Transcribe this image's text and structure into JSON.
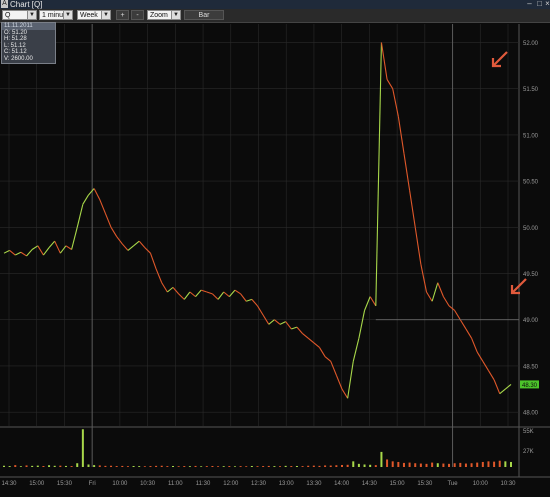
{
  "window": {
    "title": "Chart [Q]",
    "icon": "chart-app-icon"
  },
  "toolbar": {
    "symbol": "Q",
    "interval": "1 minute",
    "period": "Week",
    "plus_label": "+",
    "minus_label": "-",
    "zoom_label": "Zoom",
    "chart_type_label": "Bar"
  },
  "ohlc_box": {
    "header": "11.11.2011",
    "open": "O: 51.20",
    "high": "H: 51.28",
    "low": "L: 51.12",
    "close": "C: 51.12",
    "volume": "V: 2600.00"
  },
  "colors": {
    "up": "#a8d84a",
    "down": "#e0582a",
    "arrow": "#e15a3c",
    "grid": "#2a2a2a",
    "last_price_bg": "#4cc42a"
  },
  "chart_data": {
    "type": "line",
    "y_ticks": [
      "52.00",
      "51.50",
      "51.00",
      "50.50",
      "50.00",
      "49.50",
      "49.00",
      "48.50",
      "48.00"
    ],
    "ylim": [
      47.85,
      52.2
    ],
    "volume_ticks": [
      "55K",
      "27K"
    ],
    "volume_ylim": [
      0,
      62000
    ],
    "x_ticks": [
      "14:30",
      "15:00",
      "15:30",
      "Fri",
      "10:00",
      "10:30",
      "11:00",
      "11:30",
      "12:00",
      "12:30",
      "13:00",
      "13:30",
      "14:00",
      "14:30",
      "15:00",
      "15:30",
      "Tue",
      "10:00",
      "10:30"
    ],
    "last_price": "48.30",
    "session_separators": [
      "Fri",
      "Tue"
    ],
    "series": [
      {
        "x": [
          0,
          1,
          2,
          3,
          4,
          5,
          6,
          7,
          8,
          9,
          10,
          11,
          12,
          13,
          14,
          15,
          16,
          17,
          18,
          19,
          20,
          21,
          22,
          23,
          24,
          25,
          26,
          27,
          28,
          29,
          30,
          31,
          32,
          33,
          34,
          35,
          36,
          37,
          38,
          39,
          40,
          41,
          42,
          43,
          44,
          45,
          46,
          47,
          48,
          49,
          50,
          51,
          52,
          53,
          54,
          55,
          56,
          57,
          58,
          59,
          60,
          61,
          62,
          63,
          64,
          65,
          66,
          67,
          68,
          69,
          70,
          71,
          72,
          73,
          74,
          75,
          76,
          77,
          78,
          79,
          80,
          81,
          82,
          83,
          84,
          85,
          86,
          87,
          88,
          89,
          90
        ],
        "values": [
          49.72,
          49.75,
          49.7,
          49.73,
          49.69,
          49.76,
          49.8,
          49.7,
          49.78,
          49.85,
          49.72,
          49.8,
          49.76,
          50.0,
          50.25,
          50.35,
          50.42,
          50.3,
          50.15,
          50.0,
          49.9,
          49.82,
          49.75,
          49.8,
          49.85,
          49.78,
          49.72,
          49.55,
          49.4,
          49.3,
          49.35,
          49.28,
          49.22,
          49.3,
          49.25,
          49.32,
          49.3,
          49.28,
          49.22,
          49.3,
          49.25,
          49.32,
          49.28,
          49.2,
          49.22,
          49.15,
          49.05,
          48.95,
          49.0,
          48.95,
          48.98,
          48.9,
          48.92,
          48.85,
          48.8,
          48.75,
          48.7,
          48.6,
          48.55,
          48.4,
          48.25,
          48.15,
          48.55,
          48.8,
          49.1,
          49.25,
          49.15,
          52.0,
          51.6,
          51.5,
          51.2,
          50.8,
          50.4,
          50.0,
          49.6,
          49.3,
          49.2,
          49.4,
          49.25,
          49.15,
          49.1,
          49.0,
          48.9,
          48.8,
          48.65,
          48.55,
          48.45,
          48.35,
          48.2,
          48.25,
          48.3
        ]
      }
    ],
    "volume": [
      2000,
      1500,
      3000,
      1200,
      2500,
      1800,
      2200,
      1600,
      2800,
      1900,
      2100,
      1700,
      1500,
      6000,
      60000,
      4000,
      3000,
      2500,
      1800,
      2000,
      1500,
      1700,
      1300,
      1600,
      1400,
      1200,
      1500,
      1800,
      2000,
      1400,
      1600,
      1200,
      1500,
      1300,
      1700,
      1100,
      1400,
      1600,
      1200,
      1300,
      1500,
      1100,
      1400,
      1200,
      1600,
      1300,
      1500,
      1700,
      1400,
      1300,
      1800,
      1500,
      1600,
      1400,
      2000,
      2200,
      1800,
      2500,
      2300,
      2800,
      3200,
      3500,
      9000,
      5000,
      4000,
      3500,
      3000,
      24000,
      12000,
      9000,
      8000,
      6500,
      7000,
      6000,
      5500,
      5000,
      7000,
      6000,
      5500,
      5000,
      6000,
      6500,
      5500,
      6000,
      7000,
      8000,
      9000,
      8500,
      10000,
      9000,
      8000
    ]
  }
}
